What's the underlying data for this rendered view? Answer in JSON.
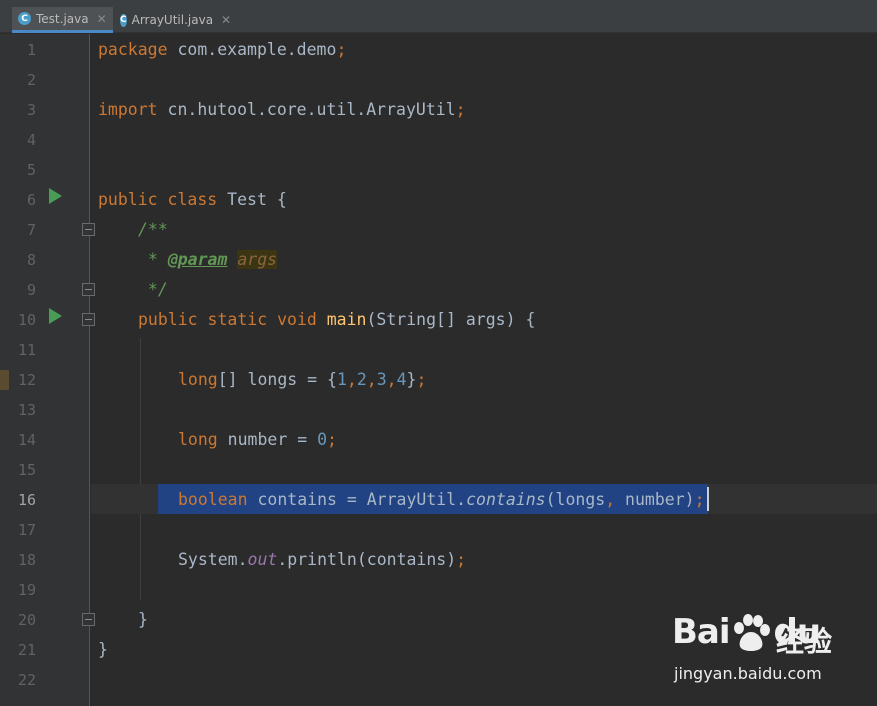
{
  "tabs": [
    {
      "label": "Test.java",
      "icon": "java-class-icon",
      "active": true
    },
    {
      "label": "ArrayUtil.java",
      "icon": "java-class-locked-icon",
      "active": false
    }
  ],
  "editor": {
    "current_line": 16,
    "line_numbers": [
      "1",
      "2",
      "3",
      "4",
      "5",
      "6",
      "7",
      "8",
      "9",
      "10",
      "11",
      "12",
      "13",
      "14",
      "15",
      "16",
      "17",
      "18",
      "19",
      "20",
      "21",
      "22"
    ],
    "lines": {
      "l1": {
        "kw": "package",
        "rest": " com.example.demo",
        "semi": ";"
      },
      "l3": {
        "kw": "import",
        "rest": " cn.hutool.core.util.ArrayUtil",
        "semi": ";"
      },
      "l6": {
        "kw": "public class",
        "rest": " Test {"
      },
      "l7": {
        "text": "/**"
      },
      "l8": {
        "star": " * ",
        "tag": "@param",
        "param": "args"
      },
      "l9": {
        "text": " */"
      },
      "l10": {
        "kw": "public static void",
        "fn": "main",
        "rest": "(String[] args) {"
      },
      "l12": {
        "kw": "long",
        "a": "[] longs = {",
        "n1": "1",
        "c1": ",",
        "n2": "2",
        "c2": ",",
        "n3": "3",
        "c3": ",",
        "n4": "4",
        "b": "}",
        "semi": ";"
      },
      "l14": {
        "kw": "long",
        "a": " number = ",
        "n": "0",
        "semi": ";"
      },
      "l16": {
        "kw": "boolean",
        "a": " contains = ArrayUtil.",
        "method": "contains",
        "b": "(longs",
        "comma": ",",
        "c": " number)",
        "semi": ";"
      },
      "l18": {
        "a": "System.",
        "field": "out",
        "b": ".println(contains)",
        "semi": ";"
      },
      "l20": {
        "text": "}"
      },
      "l21": {
        "text": "}"
      }
    }
  },
  "watermark": {
    "logo": "Bai",
    "logo2": "du",
    "cn": "经验",
    "url": "jingyan.baidu.com"
  },
  "colors": {
    "background": "#2b2b2b",
    "keyword": "#cc7832",
    "number": "#6897bb",
    "method": "#ffc66d",
    "doc_comment": "#629755",
    "selection": "#214283",
    "run_icon": "#499c54"
  }
}
